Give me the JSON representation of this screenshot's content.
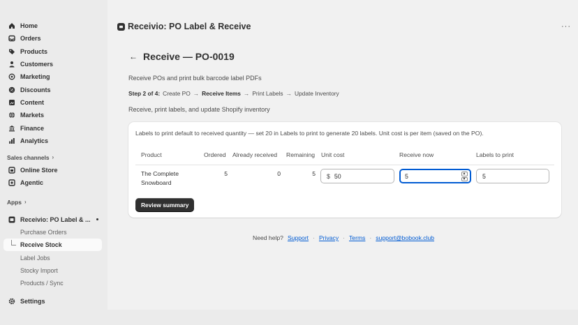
{
  "sidebar": {
    "items": [
      {
        "label": "Home",
        "icon": "home-icon"
      },
      {
        "label": "Orders",
        "icon": "inbox-icon"
      },
      {
        "label": "Products",
        "icon": "tag-icon"
      },
      {
        "label": "Customers",
        "icon": "person-icon"
      },
      {
        "label": "Marketing",
        "icon": "target-icon"
      },
      {
        "label": "Discounts",
        "icon": "discount-icon"
      },
      {
        "label": "Content",
        "icon": "content-icon"
      },
      {
        "label": "Markets",
        "icon": "globe-icon"
      },
      {
        "label": "Finance",
        "icon": "bank-icon"
      },
      {
        "label": "Analytics",
        "icon": "chart-icon"
      }
    ],
    "sales_channels_label": "Sales channels",
    "channels": [
      {
        "label": "Online Store",
        "icon": "store-icon"
      },
      {
        "label": "Agentic",
        "icon": "agentic-icon"
      }
    ],
    "apps_label": "Apps",
    "app_name": "Receivio: PO Label & ...",
    "app_sub_items": [
      "Purchase Orders",
      "Receive Stock",
      "Label Jobs",
      "Stocky Import",
      "Products / Sync"
    ],
    "settings_label": "Settings"
  },
  "header": {
    "app_title": "Receivio: PO Label & Receive",
    "more_label": "···"
  },
  "page": {
    "back_label": "←",
    "title": "Receive — PO-0019",
    "subtitle": "Receive POs and print bulk barcode label PDFs",
    "steps_prefix": "Step 2 of 4:",
    "steps": [
      "Create PO",
      "Receive Items",
      "Print Labels",
      "Update Inventory"
    ],
    "description": "Receive, print labels, and update Shopify inventory"
  },
  "card": {
    "note": "Labels to print default to received quantity — set 20 in Labels to print to generate 20 labels. Unit cost is per item (saved on the PO).",
    "columns": {
      "product": "Product",
      "ordered": "Ordered",
      "already_received": "Already received",
      "remaining": "Remaining",
      "unit_cost": "Unit cost",
      "receive_now": "Receive now",
      "labels_to_print": "Labels to print"
    },
    "row": {
      "product_line1": "The Complete",
      "product_line2": "Snowboard",
      "ordered": "5",
      "already_received": "0",
      "remaining": "5",
      "currency": "$",
      "unit_cost": "50",
      "receive_now": "5",
      "labels_to_print": "5"
    },
    "review_button": "Review summary"
  },
  "footer": {
    "help": "Need help?",
    "links": [
      "Support",
      "Privacy",
      "Terms",
      "support@bobook.club"
    ]
  },
  "colors": {
    "primary_button": "#303030",
    "focus": "#005bd3",
    "link": "#005bd3"
  }
}
